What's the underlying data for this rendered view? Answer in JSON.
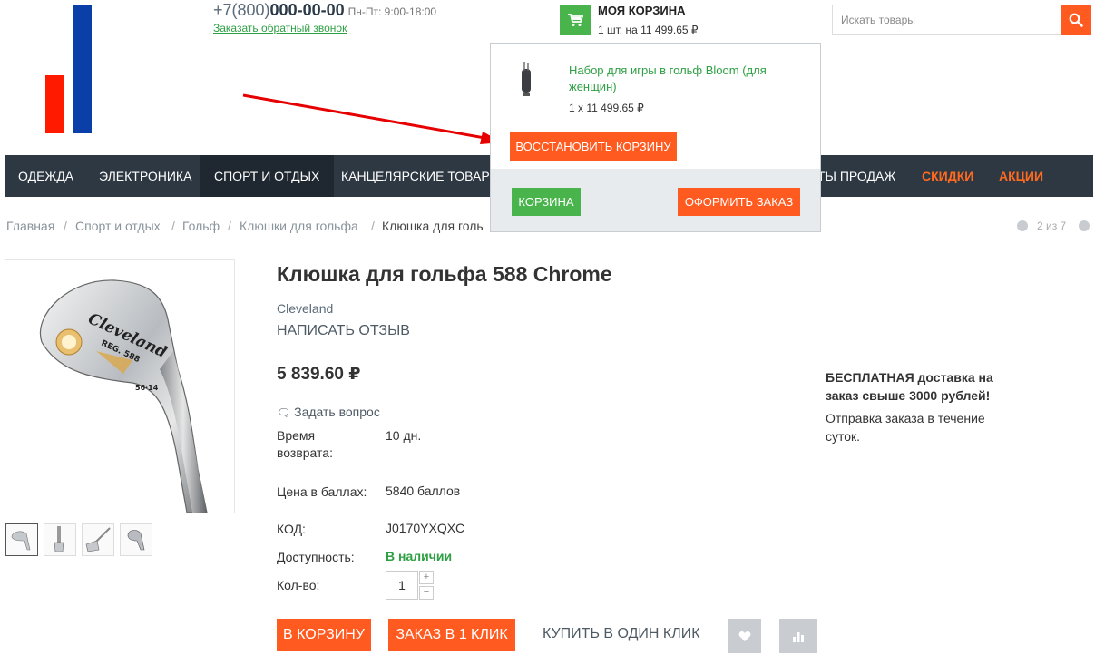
{
  "header": {
    "phone_prefix": "+7(800)",
    "phone_main": "000-00-00",
    "hours": "Пн-Пт: 9:00-18:00",
    "callback_link": "Заказать обратный звонок",
    "cart_title": "МОЯ КОРЗИНА",
    "cart_summary": "1 шт. на 11 499.65 ₽",
    "search_placeholder": "Искать товары",
    "icons": {
      "cart": "cart-icon",
      "search": "search-icon"
    },
    "colors": {
      "green": "#48b44b",
      "orange": "#ff5a1f",
      "nav_bg": "#2d3843",
      "logo_red": "#ff1a00",
      "logo_blue": "#0a3fa8"
    }
  },
  "nav": {
    "items": [
      "ОДЕЖДА",
      "ЭЛЕКТРОНИКА",
      "СПОРТ И ОТДЫХ",
      "КАНЦЕЛЯРСКИЕ ТОВАРЫ",
      "ТЫ ПРОДАЖ",
      "СКИДКИ",
      "АКЦИИ"
    ],
    "active": "СПОРТ И ОТДЫХ"
  },
  "breadcrumbs": [
    "Главная",
    "Спорт и отдых",
    "Гольф",
    "Клюшки для гольфа",
    "Клюшка для голь"
  ],
  "pager": "2 из 7",
  "product": {
    "title": "Клюшка для гольфа 588 Chrome",
    "brand": "Cleveland",
    "review_link": "НАПИСАТЬ ОТЗЫВ",
    "price": "5 839.60 ₽",
    "ask_link": "Задать вопрос",
    "return_label_1": "Время",
    "return_label_2": "возврата:",
    "return_value": "10 дн.",
    "points_label": "Цена в баллах:",
    "points_value": "5840 баллов",
    "code_label": "КОД:",
    "code_value": "J0170YXQXC",
    "availability_label": "Доступность:",
    "availability_value": "В наличии",
    "qty_label": "Кол-во:",
    "qty_value": "1",
    "qty_plus": "+",
    "qty_minus": "−",
    "add_to_cart": "В КОРЗИНУ",
    "one_click_order": "ЗАКАЗ В 1 КЛИК",
    "buy_one_click": "КУПИТЬ В ОДИН КЛИК",
    "image_engraving": {
      "brand": "Cleveland",
      "model": "REG. 588",
      "loft": "56·14"
    },
    "icons": {
      "ask": "chat-icon",
      "wishlist": "heart-icon",
      "compare": "compare-icon"
    }
  },
  "delivery": {
    "bold_text": "БЕСПЛАТНАЯ доставка на заказ свыше 3000 рублей!",
    "note": "Отправка заказа в течение суток."
  },
  "cart_popup": {
    "item_name": "Набор для игры в гольф Bloom (для женщин)",
    "item_qty": "1 x 11 499.65 ₽",
    "restore_button": "ВОССТАНОВИТЬ КОРЗИНУ",
    "cart_button": "КОРЗИНА",
    "checkout_button": "ОФОРМИТЬ ЗАКАЗ"
  }
}
